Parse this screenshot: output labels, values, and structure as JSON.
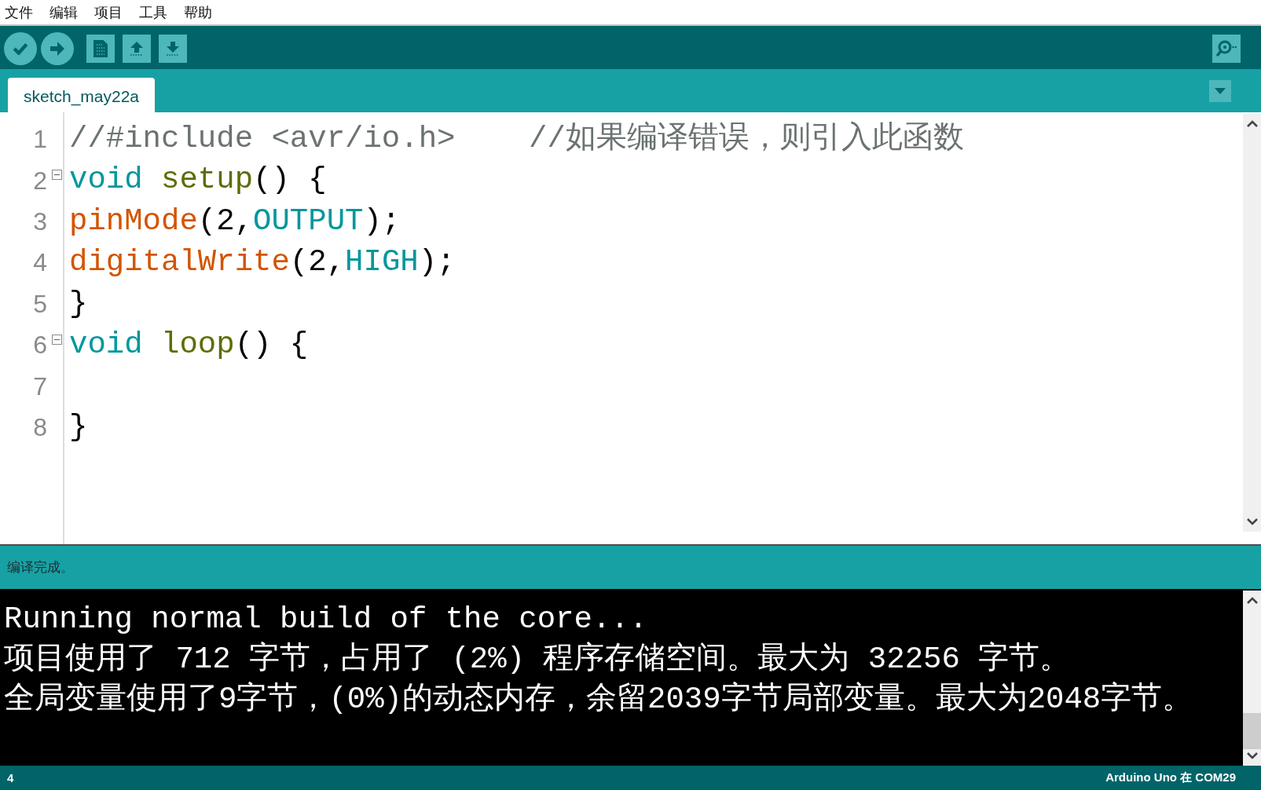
{
  "menu_bar": [
    "文件",
    "编辑",
    "项目",
    "工具",
    "帮助"
  ],
  "tabs": [
    {
      "label": "sketch_may22a",
      "selected": true
    }
  ],
  "editor": {
    "lines": [
      {
        "number": "1",
        "foldable": false,
        "tokens": [
          {
            "kind": "comment",
            "text": "//#include <avr/io.h>    //如果编译错误，则引入此函数"
          }
        ]
      },
      {
        "number": "2",
        "foldable": true,
        "tokens": [
          {
            "kind": "keyword",
            "text": "void "
          },
          {
            "kind": "function",
            "text": "setup"
          },
          {
            "kind": "plain",
            "text": "() {"
          }
        ]
      },
      {
        "number": "3",
        "foldable": false,
        "tokens": [
          {
            "kind": "builtin",
            "text": "pinMode"
          },
          {
            "kind": "plain",
            "text": "(2,"
          },
          {
            "kind": "constant",
            "text": "OUTPUT"
          },
          {
            "kind": "plain",
            "text": ");"
          }
        ]
      },
      {
        "number": "4",
        "foldable": false,
        "tokens": [
          {
            "kind": "builtin",
            "text": "digitalWrite"
          },
          {
            "kind": "plain",
            "text": "(2,"
          },
          {
            "kind": "constant",
            "text": "HIGH"
          },
          {
            "kind": "plain",
            "text": ");"
          }
        ]
      },
      {
        "number": "5",
        "foldable": false,
        "tokens": [
          {
            "kind": "plain",
            "text": "}"
          }
        ]
      },
      {
        "number": "6",
        "foldable": true,
        "tokens": [
          {
            "kind": "keyword",
            "text": "void "
          },
          {
            "kind": "function",
            "text": "loop"
          },
          {
            "kind": "plain",
            "text": "() {"
          }
        ]
      },
      {
        "number": "7",
        "foldable": false
      },
      {
        "number": "8",
        "foldable": false,
        "tokens": [
          {
            "kind": "plain",
            "text": "}"
          }
        ]
      }
    ]
  },
  "message": "编译完成。",
  "console": {
    "lines": [
      "Running normal build of the core...",
      "项目使用了 712 字节，占用了 (2%) 程序存储空间。最大为 32256 字节。",
      "全局变量使用了9字节，(0%)的动态内存，余留2039字节局部变量。最大为2048字节。"
    ]
  },
  "status_bar": {
    "line": "4",
    "board": "Arduino Uno 在 COM29"
  }
}
